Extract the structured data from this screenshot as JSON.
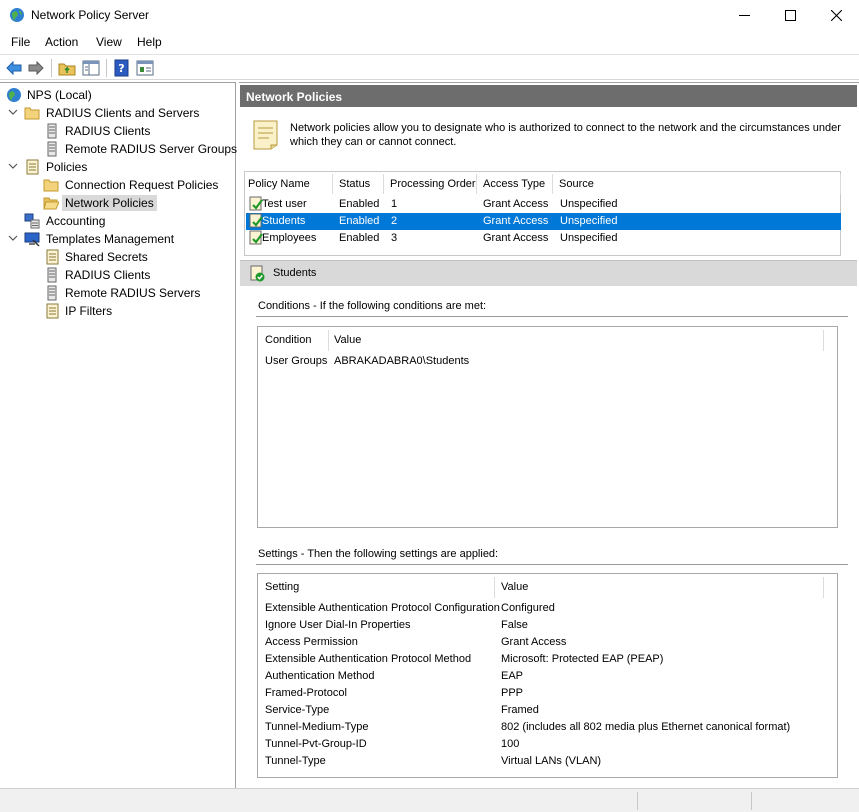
{
  "window": {
    "title": "Network Policy Server",
    "icon": "globe-icon"
  },
  "menu": [
    "File",
    "Action",
    "View",
    "Help"
  ],
  "toolbar": [
    "back-arrow-icon",
    "forward-arrow-icon",
    "up-folder-icon",
    "show-hide-tree-icon",
    "help-icon",
    "properties-icon"
  ],
  "tree": {
    "items": [
      {
        "label": "NPS (Local)"
      },
      {
        "label": "RADIUS Clients and Servers"
      },
      {
        "label": "RADIUS Clients"
      },
      {
        "label": "Remote RADIUS Server Groups"
      },
      {
        "label": "Policies"
      },
      {
        "label": "Connection Request Policies"
      },
      {
        "label": "Network Policies"
      },
      {
        "label": "Accounting"
      },
      {
        "label": "Templates Management"
      },
      {
        "label": "Shared Secrets"
      },
      {
        "label": "RADIUS Clients"
      },
      {
        "label": "Remote RADIUS Servers"
      },
      {
        "label": "IP Filters"
      }
    ]
  },
  "main": {
    "header": "Network Policies",
    "description": "Network policies allow you to designate who is authorized to connect to the network and the circumstances under which they can or cannot connect.",
    "policy_table": {
      "columns": [
        "Policy Name",
        "Status",
        "Processing Order",
        "Access Type",
        "Source"
      ],
      "rows": [
        {
          "name": "Test user",
          "status": "Enabled",
          "order": "1",
          "access": "Grant Access",
          "source": "Unspecified"
        },
        {
          "name": "Students",
          "status": "Enabled",
          "order": "2",
          "access": "Grant Access",
          "source": "Unspecified"
        },
        {
          "name": "Employees",
          "status": "Enabled",
          "order": "3",
          "access": "Grant Access",
          "source": "Unspecified"
        }
      ],
      "selected_index": 1
    },
    "selected_policy": "Students",
    "conditions": {
      "label": "Conditions - If the following conditions are met:",
      "columns": [
        "Condition",
        "Value"
      ],
      "rows": [
        {
          "condition": "User Groups",
          "value": "ABRAKADABRA0\\Students"
        }
      ]
    },
    "settings": {
      "label": "Settings - Then the following settings are applied:",
      "columns": [
        "Setting",
        "Value"
      ],
      "rows": [
        {
          "setting": "Extensible Authentication Protocol Configuration",
          "value": "Configured"
        },
        {
          "setting": "Ignore User Dial-In Properties",
          "value": "False"
        },
        {
          "setting": "Access Permission",
          "value": "Grant Access"
        },
        {
          "setting": "Extensible Authentication Protocol Method",
          "value": "Microsoft: Protected EAP (PEAP)"
        },
        {
          "setting": "Authentication Method",
          "value": "EAP"
        },
        {
          "setting": "Framed-Protocol",
          "value": "PPP"
        },
        {
          "setting": "Service-Type",
          "value": "Framed"
        },
        {
          "setting": "Tunnel-Medium-Type",
          "value": "802 (includes all 802 media plus Ethernet canonical format)"
        },
        {
          "setting": "Tunnel-Pvt-Group-ID",
          "value": "100"
        },
        {
          "setting": "Tunnel-Type",
          "value": "Virtual LANs (VLAN)"
        }
      ]
    }
  },
  "colors": {
    "selection": "#0078d7",
    "pane_header": "#6d6d6d",
    "selected_policy_header": "#d9d9d9"
  }
}
